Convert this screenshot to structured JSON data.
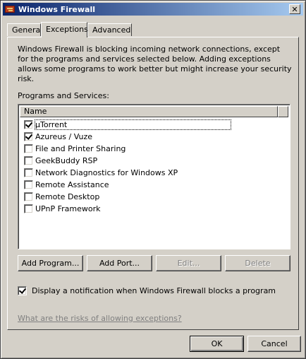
{
  "window": {
    "title": "Windows Firewall",
    "close_glyph": "✕"
  },
  "tabs": [
    {
      "label": "General",
      "active": false
    },
    {
      "label": "Exceptions",
      "active": true
    },
    {
      "label": "Advanced",
      "active": false
    }
  ],
  "description": "Windows Firewall is blocking incoming network connections, except for the programs and services selected below. Adding exceptions allows some programs to work better but might increase your security risk.",
  "programs_label": "Programs and Services:",
  "list": {
    "column_header": "Name",
    "items": [
      {
        "label": "µTorrent",
        "checked": true,
        "focused": true
      },
      {
        "label": "Azureus / Vuze",
        "checked": true,
        "focused": false
      },
      {
        "label": "File and Printer Sharing",
        "checked": false,
        "focused": false
      },
      {
        "label": "GeekBuddy RSP",
        "checked": false,
        "focused": false
      },
      {
        "label": "Network Diagnostics for Windows XP",
        "checked": false,
        "focused": false
      },
      {
        "label": "Remote Assistance",
        "checked": false,
        "focused": false
      },
      {
        "label": "Remote Desktop",
        "checked": false,
        "focused": false
      },
      {
        "label": "UPnP Framework",
        "checked": false,
        "focused": false
      }
    ]
  },
  "buttons": {
    "add_program": "Add Program...",
    "add_port": "Add Port...",
    "edit": "Edit...",
    "delete": "Delete",
    "ok": "OK",
    "cancel": "Cancel"
  },
  "notify": {
    "label": "Display a notification when Windows Firewall blocks a program",
    "checked": true
  },
  "risk_link": "What are the risks of allowing exceptions?",
  "colors": {
    "titlebar_start": "#0a246a",
    "titlebar_end": "#a6caf0",
    "face": "#d4d0c8"
  }
}
